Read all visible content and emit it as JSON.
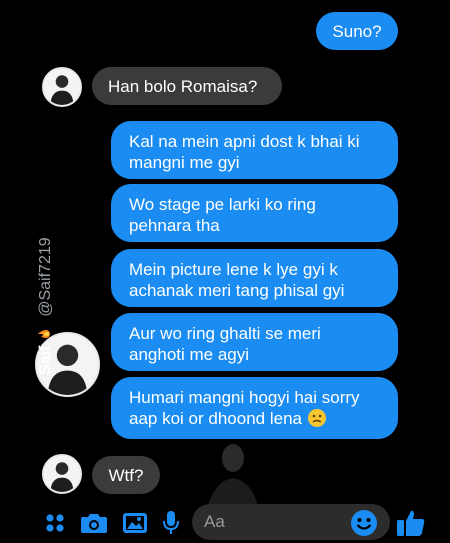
{
  "messages": [
    {
      "side": "out",
      "text": "Suno?"
    },
    {
      "side": "in",
      "text": "Han bolo Romaisa?"
    },
    {
      "side": "out",
      "text": "Kal na mein apni dost k bhai ki mangni me gyi"
    },
    {
      "side": "out",
      "text": "Wo stage pe larki ko ring pehnara tha"
    },
    {
      "side": "out",
      "text": "Mein picture lene k lye gyi k achanak meri tang phisal gyi"
    },
    {
      "side": "out",
      "text": "Aur wo ring ghalti se meri anghoti me agyi"
    },
    {
      "side": "out",
      "text": "Humari mangni hogyi hai sorry aap koi or dhoond lena"
    },
    {
      "side": "in",
      "text": "Wtf?"
    }
  ],
  "watermark": {
    "name": "Saif",
    "handle": "@Saif7219"
  },
  "composer": {
    "placeholder": "Aa"
  },
  "colors": {
    "outgoing": "#1a8cf2",
    "incoming": "#3b3b3b",
    "accent": "#1a8cf2",
    "background": "#000000"
  },
  "icons": [
    "apps-icon",
    "camera-icon",
    "gallery-icon",
    "microphone-icon",
    "emoji-icon",
    "like-icon",
    "fire-emoji-icon",
    "worried-emoji-icon"
  ]
}
